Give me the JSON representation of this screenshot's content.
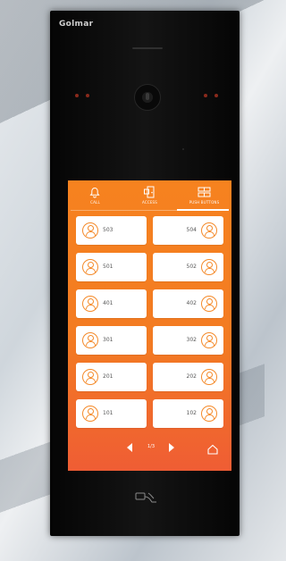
{
  "brand": {
    "logo_text": "Golmar"
  },
  "tabs": [
    {
      "label": "CALL",
      "icon": "bell-icon"
    },
    {
      "label": "ACCESS",
      "icon": "door-icon"
    },
    {
      "label": "PUSH BUTTONS",
      "icon": "keypad-icon",
      "active": true
    }
  ],
  "apartments": [
    {
      "left": "503",
      "right": "504"
    },
    {
      "left": "501",
      "right": "502"
    },
    {
      "left": "401",
      "right": "402"
    },
    {
      "left": "301",
      "right": "302"
    },
    {
      "left": "201",
      "right": "202"
    },
    {
      "left": "101",
      "right": "102"
    }
  ],
  "pager": {
    "page": "1/3"
  },
  "colors": {
    "screen_top": "#f6821f",
    "screen_bottom": "#ef5d34",
    "panel": "#0a0a0a",
    "led": "#8a2a1c"
  }
}
